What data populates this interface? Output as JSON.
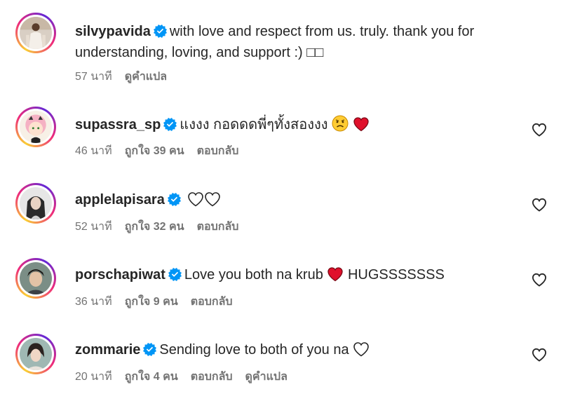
{
  "comments": [
    {
      "username": "silvypavida",
      "text_line1": "with love and respect from us. truly. thank you for",
      "text_line2": "understanding, loving, and support :) □□",
      "time": "57 นาที",
      "translate": "ดูคำแปล"
    },
    {
      "username": "supassra_sp",
      "text": "แงงง กอดดดพี่ๆทั้งสองงง",
      "time": "46 นาที",
      "likes": "ถูกใจ 39 คน",
      "reply": "ตอบกลับ"
    },
    {
      "username": "applelapisara",
      "time": "52 นาที",
      "likes": "ถูกใจ 32 คน",
      "reply": "ตอบกลับ"
    },
    {
      "username": "porschapiwat",
      "text_before": "Love you both na krub",
      "text_after": "HUGSSSSSSS",
      "time": "36 นาที",
      "likes": "ถูกใจ 9 คน",
      "reply": "ตอบกลับ"
    },
    {
      "username": "zommarie",
      "text": "Sending love to both of you na",
      "time": "20 นาที",
      "likes": "ถูกใจ 4 คน",
      "reply": "ตอบกลับ",
      "translate": "ดูคำแปล"
    }
  ],
  "colors": {
    "verified": "#0095f6",
    "meta": "#737373",
    "text": "#262626",
    "heart_red": "#e0102b"
  },
  "icons": {
    "verified": "verified-badge-icon",
    "like": "heart-outline-icon",
    "red_heart": "red-heart-emoji",
    "sad_face": "sad-face-emoji"
  }
}
